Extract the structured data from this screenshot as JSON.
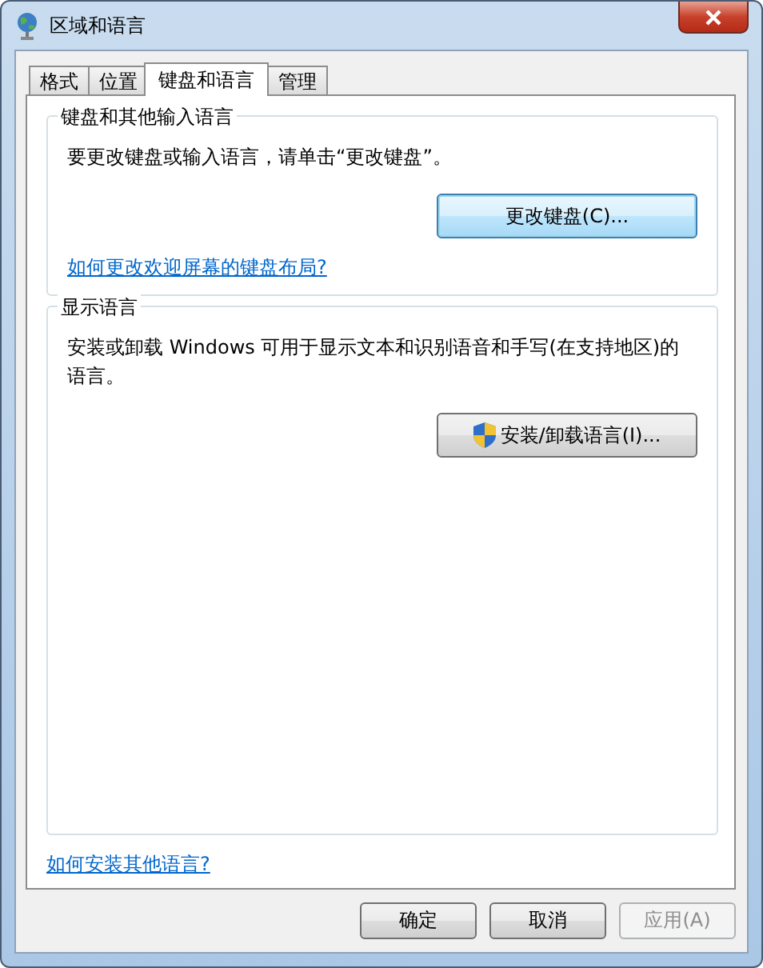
{
  "window": {
    "title": "区域和语言"
  },
  "tabs": [
    {
      "label": "格式",
      "selected": false
    },
    {
      "label": "位置",
      "selected": false
    },
    {
      "label": "键盘和语言",
      "selected": true
    },
    {
      "label": "管理",
      "selected": false
    }
  ],
  "groups": [
    {
      "title": "键盘和其他输入语言",
      "text": "要更改键盘或输入语言，请单击“更改键盘”。",
      "button": {
        "label": "更改键盘(C)...",
        "focused": true,
        "requires_admin": false
      },
      "link": "如何更改欢迎屏幕的键盘布局?"
    },
    {
      "title": "显示语言",
      "text": "安装或卸载 Windows 可用于显示文本和识别语音和手写(在支持地区)的语言。",
      "button": {
        "label": "安装/卸载语言(I)...",
        "focused": false,
        "requires_admin": true
      }
    }
  ],
  "page_link": "如何安装其他语言?",
  "buttons": [
    {
      "label": "确定",
      "disabled": false
    },
    {
      "label": "取消",
      "disabled": false
    },
    {
      "label": "应用(A)",
      "disabled": true
    }
  ]
}
